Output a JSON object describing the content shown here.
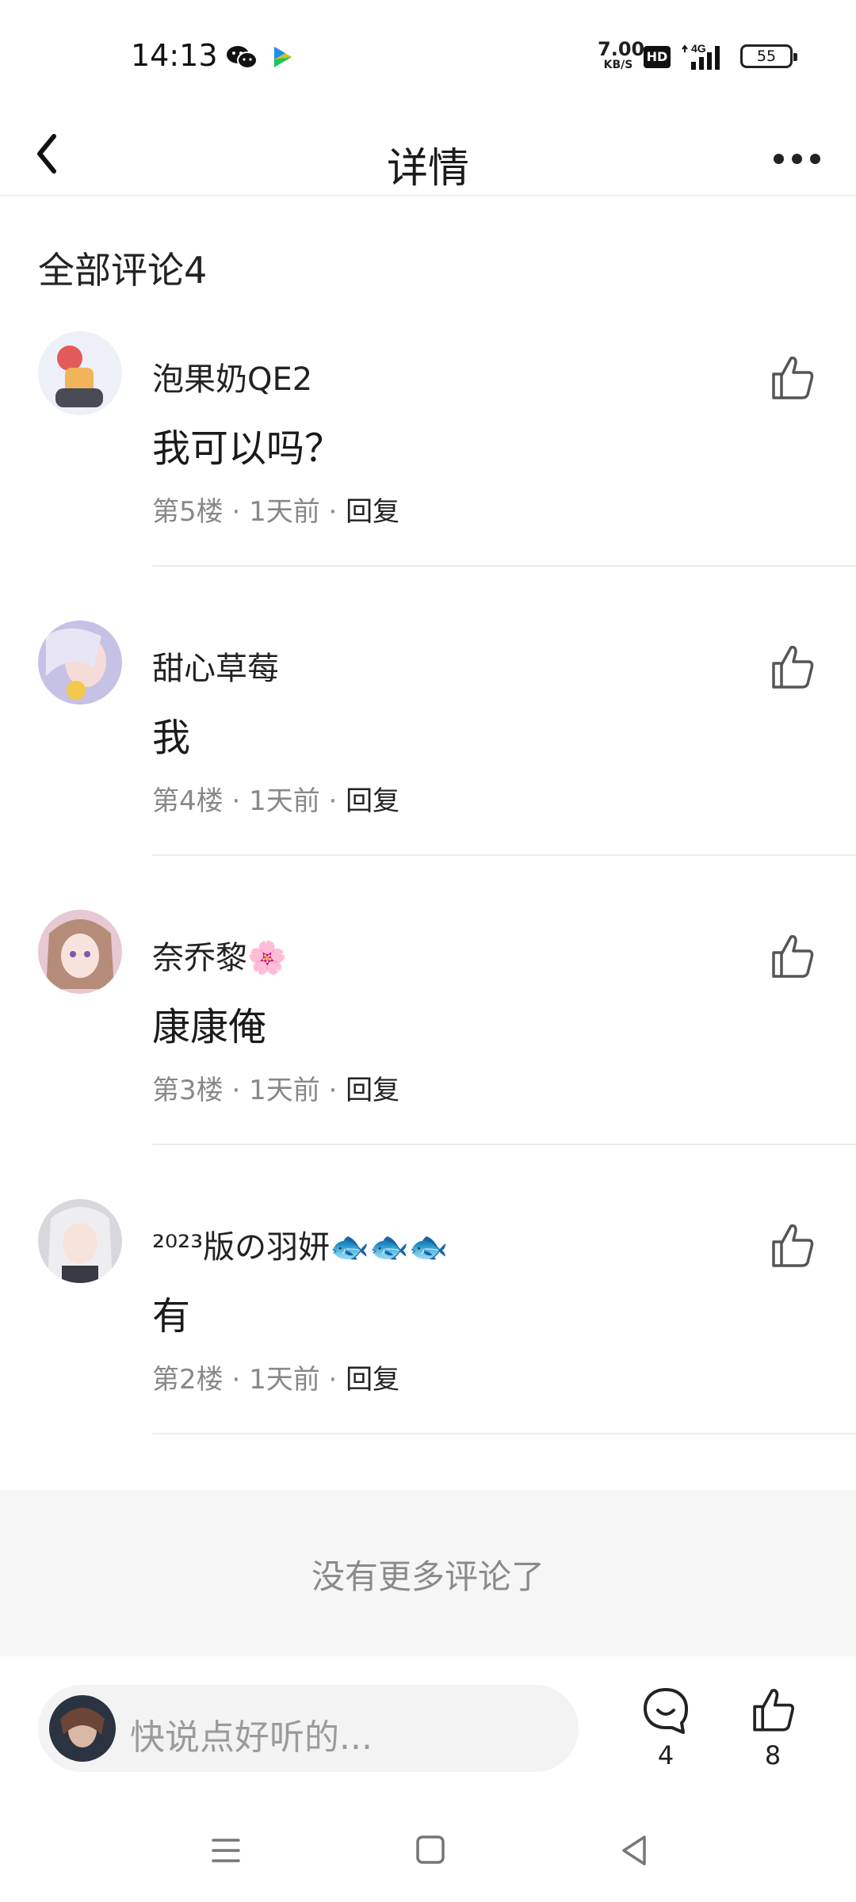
{
  "status_bar": {
    "time": "14:13",
    "net_speed_value": "7.00",
    "net_speed_unit": "KB/S",
    "hd_badge": "HD",
    "network_type": "4G",
    "battery": "55",
    "notification_icons": [
      "wechat-icon",
      "video-play-icon"
    ]
  },
  "header": {
    "title": "详情",
    "back_icon": "chevron-left-icon",
    "more_icon": "more-dots-icon"
  },
  "comments_section": {
    "title": "全部评论4",
    "items": [
      {
        "name": "泡果奶QE2",
        "text": "我可以吗？",
        "floor": "第5楼",
        "time": "1天前",
        "reply": "回复",
        "sep": "·",
        "avatar_color": "#f2b45a"
      },
      {
        "name": "甜心草莓",
        "text": "我",
        "floor": "第4楼",
        "time": "1天前",
        "reply": "回复",
        "sep": "·",
        "avatar_color": "#c6c2e6"
      },
      {
        "name": "奈乔黎",
        "name_emoji": "🌸",
        "text": "康康俺",
        "floor": "第3楼",
        "time": "1天前",
        "reply": "回复",
        "sep": "·",
        "avatar_color": "#e6c9d2"
      },
      {
        "name": "²⁰²³版の羽妍",
        "name_emoji": "🐟🐟🐟",
        "text": "有",
        "floor": "第2楼",
        "time": "1天前",
        "reply": "回复",
        "sep": "·",
        "avatar_color": "#d8d8dc"
      }
    ],
    "like_icon": "thumbs-up-icon"
  },
  "no_more": {
    "text": "没有更多评论了"
  },
  "bottom_bar": {
    "input_placeholder": "快说点好听的...",
    "comment_count": "4",
    "like_count": "8"
  },
  "colors": {
    "divider": "#ececec",
    "meta_text": "#888888",
    "band_bg": "#f6f6f6"
  }
}
